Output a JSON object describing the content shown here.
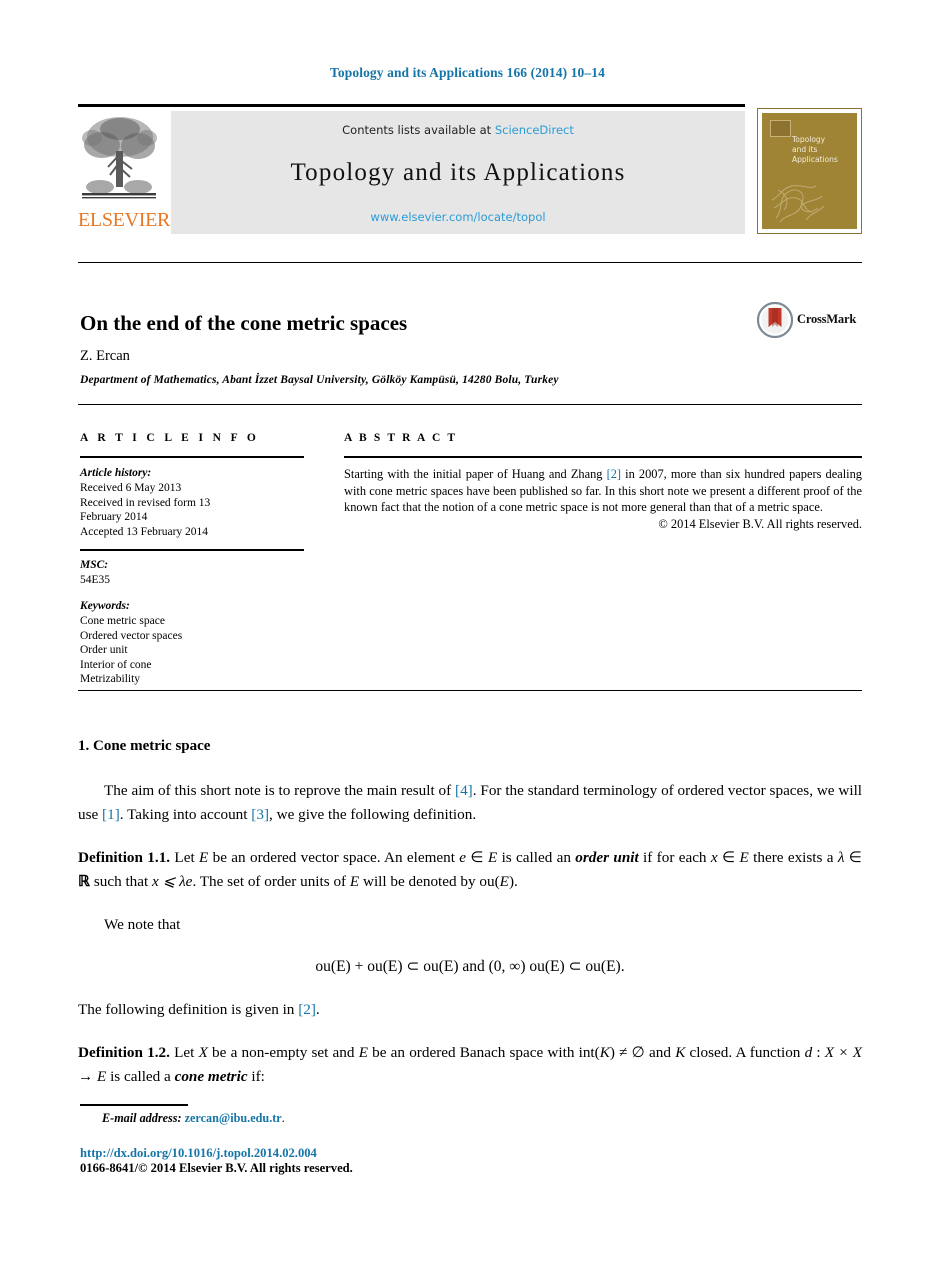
{
  "running_head": "Topology and its Applications 166 (2014) 10–14",
  "masthead": {
    "publisher_name": "ELSEVIER",
    "publisher_logo_icon": "elsevier-tree-icon",
    "contents_prefix": "Contents lists available at ",
    "sciencedirect_link": "ScienceDirect",
    "journal_title": "Topology and its Applications",
    "journal_url": "www.elsevier.com/locate/topol",
    "cover": {
      "title_line1": "Topology",
      "title_line2": "and its",
      "title_line3": "Applications",
      "background_color": "#a08436"
    }
  },
  "article": {
    "title": "On the end of the cone metric spaces",
    "author": "Z. Ercan",
    "affiliation": "Department of Mathematics, Abant İzzet Baysal University, Gölköy Kampüsü, 14280 Bolu, Turkey",
    "crossmark_label": "CrossMark"
  },
  "info": {
    "heading": "A R T I C L E   I N F O",
    "history_label": "Article history:",
    "history_lines": [
      "Received 6 May 2013",
      "Received in revised form 13",
      "February 2014",
      "Accepted 13 February 2014"
    ],
    "msc_label": "MSC:",
    "msc_value": "54E35",
    "keywords_label": "Keywords:",
    "keywords": [
      "Cone metric space",
      "Ordered vector spaces",
      "Order unit",
      "Interior of cone",
      "Metrizability"
    ]
  },
  "abstract": {
    "heading": "A B S T R A C T",
    "text_part1": "Starting with the initial paper of Huang and Zhang ",
    "ref1": "[2]",
    "text_part2": " in 2007, more than six hundred papers dealing with cone metric spaces have been published so far. In this short note we present a different proof of the known fact that the notion of a cone metric space is not more general than that of a metric space.",
    "copyright": "© 2014 Elsevier B.V. All rights reserved."
  },
  "body": {
    "section_number_title": "1. Cone metric space",
    "para1_a": "The aim of this short note is to reprove the main result of ",
    "para1_ref4": "[4]",
    "para1_b": ". For the standard terminology of ordered vector spaces, we will use ",
    "para1_ref1": "[1]",
    "para1_c": ". Taking into account ",
    "para1_ref3": "[3]",
    "para1_d": ", we give the following definition.",
    "def11_label": "Definition 1.1.",
    "def11_a": " Let ",
    "def11_E1": "E",
    "def11_b": " be an ordered vector space. An element ",
    "def11_e": "e",
    "def11_c": " ∈ ",
    "def11_E2": "E",
    "def11_d": " is called an ",
    "def11_orderunit": "order unit",
    "def11_f": " if for each ",
    "def11_x": "x",
    "def11_g": " ∈ ",
    "def11_E3": "E",
    "def11_h": " there exists a ",
    "def11_lambda": "λ",
    "def11_i": " ∈ ",
    "def11_R": "ℝ",
    "def11_j": " such that ",
    "def11_ineq": "x ⩽ λe",
    "def11_k": ". The set of order units of ",
    "def11_E4": "E",
    "def11_l": " will be denoted by ou(",
    "def11_E5": "E",
    "def11_m": ").",
    "wenote": "We note that",
    "display_math": "ou(E) + ou(E) ⊂ ou(E)   and   (0, ∞) ou(E) ⊂ ou(E).",
    "following_a": "The following definition is given in ",
    "following_ref2": "[2]",
    "following_b": ".",
    "def12_label": "Definition 1.2.",
    "def12_a": " Let ",
    "def12_X1": "X",
    "def12_b": " be a non-empty set and ",
    "def12_E1": "E",
    "def12_c": " be an ordered Banach space with int(",
    "def12_K1": "K",
    "def12_d": ") ≠ ∅ and ",
    "def12_K2": "K",
    "def12_e": " closed. A function ",
    "def12_d_fn": "d",
    "def12_f": " : ",
    "def12_XxX": "X × X → E",
    "def12_g": " is called a ",
    "def12_conemetric": "cone metric",
    "def12_h": " if:"
  },
  "footer": {
    "email_label": "E-mail address:",
    "email_address": "zercan@ibu.edu.tr",
    "email_suffix": ".",
    "doi": "http://dx.doi.org/10.1016/j.topol.2014.02.004",
    "issn_copyright": "0166-8641/© 2014 Elsevier B.V. All rights reserved."
  },
  "colors": {
    "link_blue": "#1675a8",
    "sciencedirect_blue": "#2b9bd6",
    "elsevier_orange": "#e87722",
    "banner_gray": "#e6e6e6",
    "cover_olive": "#a08436"
  }
}
